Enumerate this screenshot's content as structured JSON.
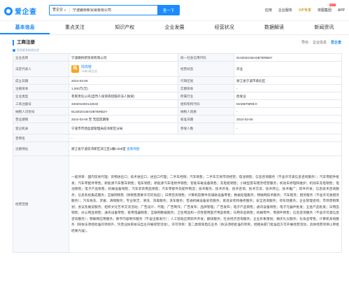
{
  "header": {
    "logo_text": "爱企查",
    "search_scope": "查企业",
    "search_value": "宁波路桥新贸易有限公司",
    "search_button": "查一下",
    "nav": [
      "应用",
      "企业服务",
      "VIP专享",
      "依图集团",
      "APP"
    ],
    "hot_badge": "HOT"
  },
  "tabs": [
    "基本信息",
    "重点关注",
    "知识产权",
    "企业发展",
    "经营状况",
    "数据解读",
    "新闻资讯"
  ],
  "section": {
    "title": "工商注册",
    "sub_link": "发现更多新闻信息",
    "tools": [
      "导出",
      "企业信息",
      "爱企查"
    ]
  },
  "table": {
    "company_name_label": "企业名称",
    "company_name": "宁波路桥新贸易有限公司",
    "credit_code_label": "统一社会信用代码",
    "credit_code": "91330201MADBTBRB0Y",
    "legal_rep_label": "法定代表人",
    "legal_rep_avatar": "陆",
    "legal_rep_name": "陆高敬",
    "legal_rep_sub": "TA有1家企业",
    "status_label": "经营状态",
    "status": "开业",
    "found_date_label": "成立日期",
    "found_date": "2024-03-06",
    "authority_label": "行政区划",
    "authority": "浙江省宁波市甬北区",
    "reg_capital_label": "注册资本",
    "reg_capital": "1,000万(元)",
    "paid_capital_label": "实缴资本",
    "paid_capital": "-",
    "company_type_label": "企业类型",
    "company_type": "有限责任公司(自然人投资或控股的法人独资)",
    "industry_label": "所属行业",
    "industry": "批发业",
    "reg_no_label": "工商注册号",
    "reg_no": "330201000143040",
    "org_code_label": "组织机构代码",
    "org_code": "MADBTBRB-0",
    "taxpayer_id_label": "纳税人识别号",
    "taxpayer_id": "91330201MADBTBRB2Y",
    "taxpayer_qual_label": "纳税人资质",
    "taxpayer_qual": "-",
    "biz_term_label": "营业期限",
    "biz_term": "2024-03-06 至 无固定期限",
    "approve_date_label": "核准日期",
    "approve_date": "2024-03-06",
    "reg_authority_label": "登记机关",
    "reg_authority": "宁波市市场监督管理局前湾新区分局",
    "insured_label": "参保人数",
    "insured": "-",
    "former_name_label": "曾用名",
    "former_name": "-",
    "address_label": "注册地址",
    "address": "浙江省宁波前湾新区滨江区1幢C206室",
    "map_link": "查看地图",
    "scope_label": "经营范围",
    "scope": "一般项目：国内贸易代理；货物进出口；技术进出口；进出口代理；二手车经销；汽车销售；二手车交易市场经营；电池销售；信息咨询服务（不含许可类信息咨询服务）；汽车零配件批发；汽车零配件零售；新能源汽车整车销售；电车销售；新能源汽车电附件销售；智能车载设备销售；充电桩销售；小微型客车租赁经营服务；机动车修理和维护；机动车充电销售；电池销售；电子产品销售；机械设备销售；汽车装饰用品销售；汽车零部件及配件制造；技术服务、技术开发、技术咨询、技术交流、技术转让、技术推广；软件开发；信息技术咨询服务；信息系统集成服务；互联网销售（除销售需要许可的商品）；日用百货销售；计算机软硬件及辅助设备零售；数据处理服务；物联网技术服务；汽车租赁；租赁服务（不含许可类租赁服务）；汽车拖车、求援、清障服务；专业保洁、清洗、消毒服务；洗车服务；普通机械设备安装服务；家具安装和维修服务；安全咨询服务；停车场服务；企业管理咨询；市场营销策划；会议及展览服务；组织文化艺术交流活动；广告设计、代理；广告制作；广告发布；品牌管理；广告发布；电子产品销售；通讯设备销售；电子元器件批发；五金产品批发；日用品销售；办公用品销售；通讯设备零售；家用电器销售；互联网数据服务；卫生用品和一次性使用医疗用品销售；日用杂品销售；机械零件、零部件销售；信息咨询服务（不含许可类信息咨询服务）；物联网应用服务；数字内容制作服务（不含出版发行）；人工智能应用软件开发；翻译服务；社会经济咨询服务；企业形象策划；婚庆礼仪服务；化妆品零售；计算机系统服务（除依法须经批准的项目外，凭营业执照依法自主开展经营活动）。许可项目：第二类增值电信业务（依法须经批准的项目，经相关部门批准后方可开展经营活动，具体经营项目以审批结果为准）。"
  }
}
